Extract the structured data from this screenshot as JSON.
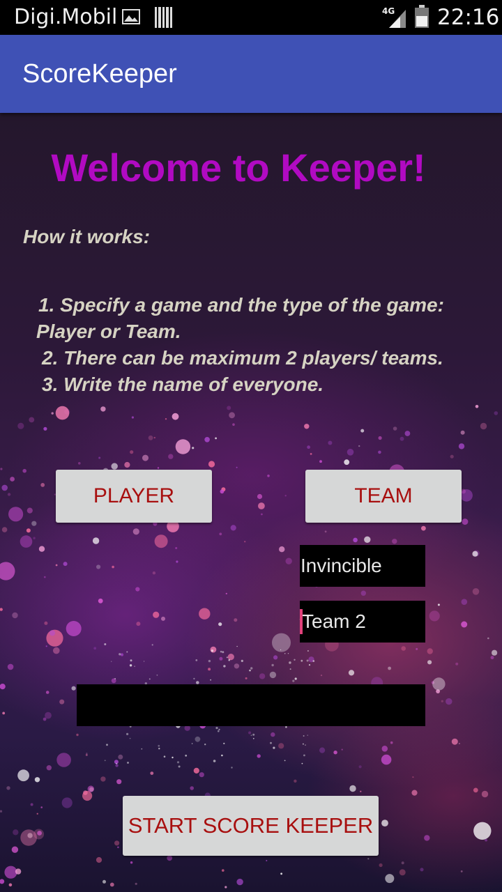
{
  "status_bar": {
    "carrier": "Digi.Mobil",
    "network": "4G",
    "time": "22:16",
    "icons": [
      "gallery-icon",
      "barcode-icon",
      "signal-icon",
      "battery-icon"
    ]
  },
  "action_bar": {
    "title": "ScoreKeeper",
    "color": "#3f51b5"
  },
  "main": {
    "welcome": "Welcome to Keeper!",
    "how_title": "How it works:",
    "steps": [
      "1. Specify a game and the type of the game:",
      "Player or Team.",
      "2. There can be maximum 2 players/ teams.",
      "3. Write the name of everyone."
    ],
    "player_button": "PLAYER",
    "team_button": "TEAM",
    "name_1": "Invincible",
    "name_2": "Team 2",
    "game_name": "",
    "start_button": "START SCORE KEEPER"
  },
  "colors": {
    "welcome": "#b10ac2",
    "button_text": "#a80f0f",
    "button_bg": "#d6d7d7",
    "body_text": "#d6d3c3",
    "cursor": "#e0417a"
  }
}
